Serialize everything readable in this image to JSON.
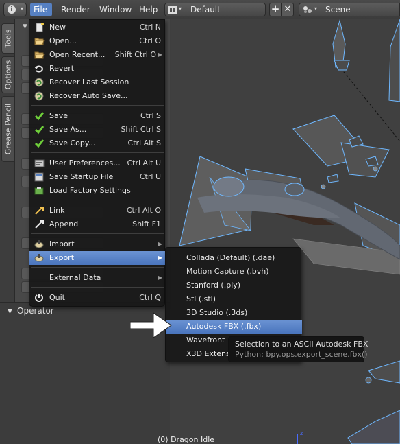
{
  "header": {
    "menus": [
      "File",
      "Render",
      "Window",
      "Help"
    ],
    "screen_layout": "Default",
    "scene": "Scene"
  },
  "sidebar": {
    "tabs": [
      "Tools",
      "Options",
      "Grease Pencil"
    ]
  },
  "operator_panel": {
    "title": "Operator"
  },
  "viewport": {
    "object_label": "(0) Dragon Idle"
  },
  "file_menu": {
    "items": [
      {
        "icon": "new-file-icon",
        "label": "New",
        "shortcut": "Ctrl N"
      },
      {
        "icon": "folder-open-icon",
        "label": "Open...",
        "shortcut": "Ctrl O"
      },
      {
        "icon": "folder-open-icon",
        "label": "Open Recent...",
        "shortcut": "Shift Ctrl O"
      },
      {
        "icon": "revert-icon",
        "label": "Revert",
        "shortcut": ""
      },
      {
        "icon": "recover-icon",
        "label": "Recover Last Session",
        "shortcut": ""
      },
      {
        "icon": "recover-icon",
        "label": "Recover Auto Save...",
        "shortcut": ""
      },
      {
        "icon": "checkmark-icon",
        "label": "Save",
        "shortcut": "Ctrl S"
      },
      {
        "icon": "checkmark-icon",
        "label": "Save As...",
        "shortcut": "Shift Ctrl S"
      },
      {
        "icon": "checkmark-icon",
        "label": "Save Copy...",
        "shortcut": "Ctrl Alt S"
      },
      {
        "icon": "preferences-icon",
        "label": "User Preferences...",
        "shortcut": "Ctrl Alt U"
      },
      {
        "icon": "save-startup-icon",
        "label": "Save Startup File",
        "shortcut": "Ctrl U"
      },
      {
        "icon": "load-factory-icon",
        "label": "Load Factory Settings",
        "shortcut": ""
      },
      {
        "icon": "link-icon",
        "label": "Link",
        "shortcut": "Ctrl Alt O"
      },
      {
        "icon": "append-icon",
        "label": "Append",
        "shortcut": "Shift F1"
      },
      {
        "icon": "import-icon",
        "label": "Import",
        "shortcut": ""
      },
      {
        "icon": "export-icon",
        "label": "Export",
        "shortcut": ""
      },
      {
        "icon": "external-data-icon",
        "label": "External Data",
        "shortcut": ""
      },
      {
        "icon": "power-icon",
        "label": "Quit",
        "shortcut": "Ctrl Q"
      }
    ]
  },
  "export_menu": {
    "items": [
      "Collada (Default) (.dae)",
      "Motion Capture (.bvh)",
      "Stanford (.ply)",
      "Stl (.stl)",
      "3D Studio (.3ds)",
      "Autodesk FBX (.fbx)",
      "Wavefront",
      "X3D Extens"
    ],
    "highlighted": "Autodesk FBX (.fbx)"
  },
  "tooltip": {
    "description": "Selection to an ASCII Autodesk FBX",
    "python": "Python: bpy.ops.export_scene.fbx()"
  },
  "colors": {
    "menu_bg": "#181818",
    "highlight": "#5680c2",
    "selection_outline": "#5fb3ff"
  }
}
